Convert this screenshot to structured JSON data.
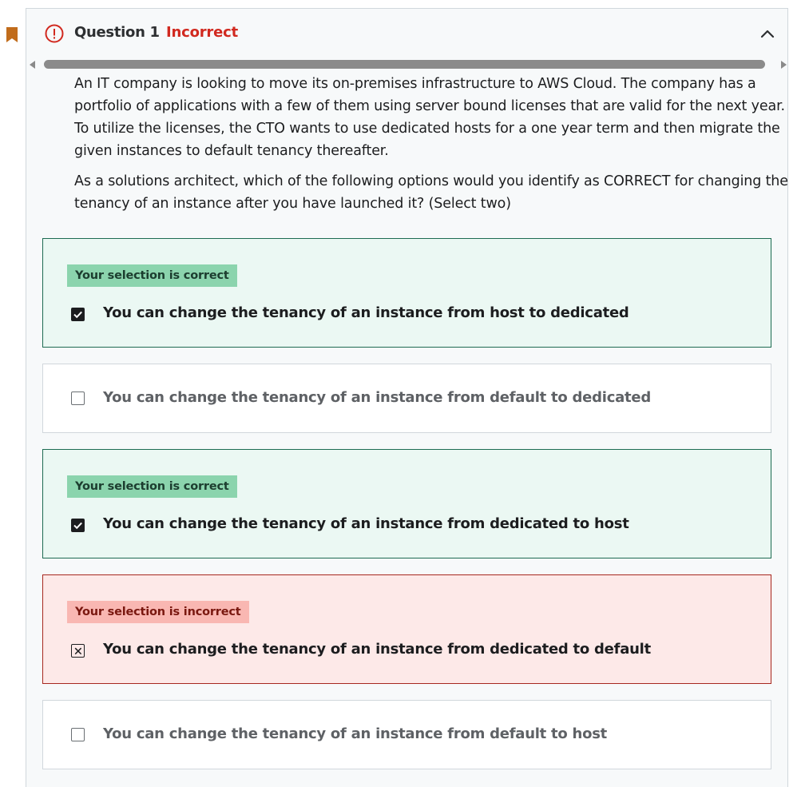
{
  "colors": {
    "bookmark": "#c16c1b",
    "incorrect_red": "#d1291f",
    "correct_bg": "#ebf8f3",
    "correct_badge": "#8bd4ad",
    "incorrect_bg": "#fde9e8",
    "incorrect_badge": "#f9b7b2"
  },
  "icons": {
    "bookmark": "bookmark-icon",
    "alert": "alert-circle-icon",
    "collapse": "chevron-up-icon"
  },
  "question": {
    "title": "Question 1",
    "status": "Incorrect",
    "paragraphs": [
      "An IT company is looking to move its on-premises infrastructure to AWS Cloud. The company has a portfolio of applications with a few of them using server bound licenses that are valid for the next year. To utilize the licenses, the CTO wants to use dedicated hosts for a one year term and then migrate the given instances to default tenancy thereafter.",
      "As a solutions architect, which of the following options would you identify as CORRECT for changing the tenancy of an instance after you have launched it? (Select two)"
    ]
  },
  "options": [
    {
      "badge": "Your selection is correct",
      "text": "You can change the tenancy of an instance from host to dedicated",
      "state": "correct",
      "checked": true
    },
    {
      "badge": "",
      "text": "You can change the tenancy of an instance from default to dedicated",
      "state": "neutral",
      "checked": false
    },
    {
      "badge": "Your selection is correct",
      "text": "You can change the tenancy of an instance from dedicated to host",
      "state": "correct",
      "checked": true
    },
    {
      "badge": "Your selection is incorrect",
      "text": "You can change the tenancy of an instance from dedicated to default",
      "state": "incorrect",
      "checked": true
    },
    {
      "badge": "",
      "text": "You can change the tenancy of an instance from default to host",
      "state": "neutral",
      "checked": false
    }
  ]
}
